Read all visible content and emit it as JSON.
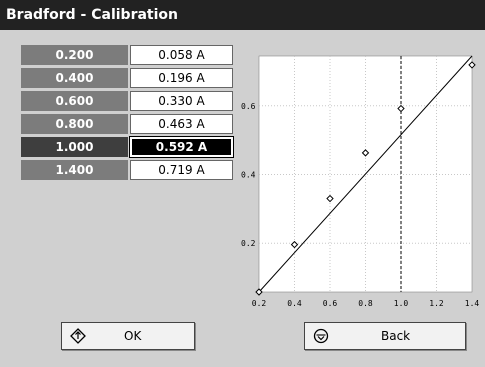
{
  "window": {
    "title": "Bradford - Calibration"
  },
  "calibration": {
    "rows": [
      {
        "standard": "0.200",
        "absorbance": "0.058 A"
      },
      {
        "standard": "0.400",
        "absorbance": "0.196 A"
      },
      {
        "standard": "0.600",
        "absorbance": "0.330 A"
      },
      {
        "standard": "0.800",
        "absorbance": "0.463 A"
      },
      {
        "standard": "1.000",
        "absorbance": "0.592 A",
        "selected": true
      },
      {
        "standard": "1.400",
        "absorbance": "0.719 A"
      }
    ]
  },
  "chart_data": {
    "type": "scatter",
    "points": [
      {
        "x": 0.2,
        "y": 0.058
      },
      {
        "x": 0.4,
        "y": 0.196
      },
      {
        "x": 0.6,
        "y": 0.33
      },
      {
        "x": 0.8,
        "y": 0.463
      },
      {
        "x": 1.0,
        "y": 0.592
      },
      {
        "x": 1.4,
        "y": 0.719
      }
    ],
    "fit_line": [
      {
        "x": 0.2,
        "y": 0.058
      },
      {
        "x": 1.4,
        "y": 0.745
      }
    ],
    "selected_x": 1.0,
    "xlim": [
      0.2,
      1.4
    ],
    "ylim": [
      0.058,
      0.745
    ],
    "xticks": [
      "0.2",
      "0.4",
      "0.6",
      "0.8",
      "1.0",
      "1.2",
      "1.4"
    ],
    "xtick_values": [
      0.2,
      0.4,
      0.6,
      0.8,
      1.0,
      1.2,
      1.4
    ],
    "yticks": [
      "0.2",
      "0.4",
      "0.6"
    ],
    "ytick_values": [
      0.2,
      0.4,
      0.6
    ],
    "grid": true
  },
  "buttons": {
    "ok_label": "OK",
    "back_label": "Back"
  },
  "colors": {
    "title_bg": "#222222",
    "panel_bg": "#d0d0d0",
    "standard_cell": "#7c7c7c",
    "selected_cell": "#000000"
  },
  "icons": {
    "ok": "diamond-arrow-icon",
    "back": "circle-arrow-down-icon"
  }
}
